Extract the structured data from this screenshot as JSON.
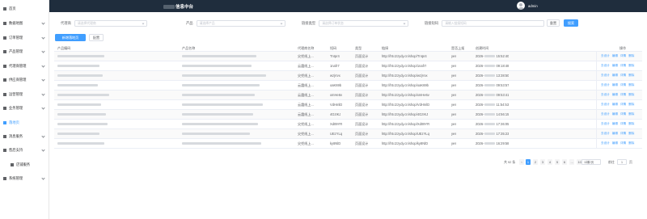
{
  "header": {
    "title": "信息中台",
    "user": "admin"
  },
  "sidebar": {
    "items": [
      {
        "label": "首页"
      },
      {
        "label": "数据地图"
      },
      {
        "label": "订单管理"
      },
      {
        "label": "产品管理"
      },
      {
        "label": "代理商管理"
      },
      {
        "label": "供应商管理"
      },
      {
        "label": "运营管理"
      },
      {
        "label": "业务管理"
      },
      {
        "label": "落地页"
      },
      {
        "label": "消息服务"
      },
      {
        "label": "售后支持"
      },
      {
        "label": "店铺服务"
      },
      {
        "label": "系统管理"
      }
    ]
  },
  "filters": {
    "agent_label": "代理商",
    "agent_placeholder": "请选择代理商",
    "product_label": "产品",
    "product_placeholder": "请选择产品",
    "type_label": "链接类型",
    "type_placeholder": "请选择订单状态",
    "code_label": "链接短码",
    "code_placeholder": "请输入链接短码",
    "reset": "重置",
    "search": "搜索"
  },
  "actions": {
    "add": "新增落地页",
    "config": "配置"
  },
  "table": {
    "columns": [
      "产品编码",
      "产品名称",
      "代理商名称",
      "短码",
      "类型",
      "链接",
      "是否上架",
      "创建时间",
      "操作"
    ],
    "rows": [
      {
        "agent": "尖兜线上...",
        "code": "TnIpr4",
        "type": "页面设计",
        "link": "http://h5.tzzydy.cn/shop/TnIpr4",
        "listed": "yes",
        "date_a": "2026-",
        "date_b": "15:52:40"
      },
      {
        "agent": "云霞线上...",
        "code": "1nafr7",
        "type": "页面设计",
        "link": "http://h5.tzzydy.cn/shop/1nafr7",
        "listed": "yes",
        "date_a": "2026-",
        "date_b": "09:18:48"
      },
      {
        "agent": "尖兜线上...",
        "code": "wzjVvx",
        "type": "页面设计",
        "link": "http://h5.tzzydy.cn/shop/wzjVvx",
        "listed": "yes",
        "date_a": "2026-",
        "date_b": "13:38:50"
      },
      {
        "agent": "云霞线上...",
        "code": "oaK69b",
        "type": "页面设计",
        "link": "http://h5.tzzydy.cn/shop/oaK69b",
        "listed": "yes",
        "date_a": "2026-",
        "date_b": "09:53:57"
      },
      {
        "agent": "云霞线上...",
        "code": "xmHe6v",
        "type": "页面设计",
        "link": "http://h5.tzzydy.cn/shop/xmHe6v",
        "listed": "yes",
        "date_a": "2026-",
        "date_b": "09:53:41"
      },
      {
        "agent": "云霞线上...",
        "code": "VdHmlD",
        "type": "页面设计",
        "link": "http://h5.tzzydy.cn/shop/VdHmlD",
        "listed": "yes",
        "date_a": "2026-",
        "date_b": "11:54:53"
      },
      {
        "agent": "云霞线上...",
        "code": "4GzIKJ",
        "type": "页面设计",
        "link": "http://h5.tzzydy.cn/shop/4GzIKJ",
        "listed": "yes",
        "date_a": "2026-",
        "date_b": "14:56:15"
      },
      {
        "agent": "尖兜线上...",
        "code": "Xd09YR",
        "type": "页面设计",
        "link": "http://h5.tzzydy.cn/shop/Xd09YR",
        "listed": "yes",
        "date_a": "2026-",
        "date_b": "17:36:05"
      },
      {
        "agent": "尖兜线上...",
        "code": "UEzYLq",
        "type": "页面设计",
        "link": "http://h5.tzzydy.cn/shop/UEzYLq",
        "listed": "yes",
        "date_a": "2026-",
        "date_b": "17:35:23"
      },
      {
        "agent": "尖兜线上...",
        "code": "ky8NlD",
        "type": "页面设计",
        "link": "http://h5.tzzydy.cn/shop/ky8NlD",
        "listed": "yes",
        "date_a": "2026-",
        "date_b": "16:29:58"
      }
    ],
    "ops": [
      "去设计",
      "编辑",
      "详情",
      "删除"
    ]
  },
  "pagination": {
    "total": "共 92 条",
    "pages": [
      "1",
      "2",
      "3",
      "4",
      "5",
      "6",
      "...",
      "10"
    ],
    "page_size": "10条/页",
    "goto_label": "前往",
    "goto_value": "1",
    "page_suffix": "页"
  },
  "colors": {
    "accent": "#409eff",
    "header_bg": "#1f2d3d"
  }
}
